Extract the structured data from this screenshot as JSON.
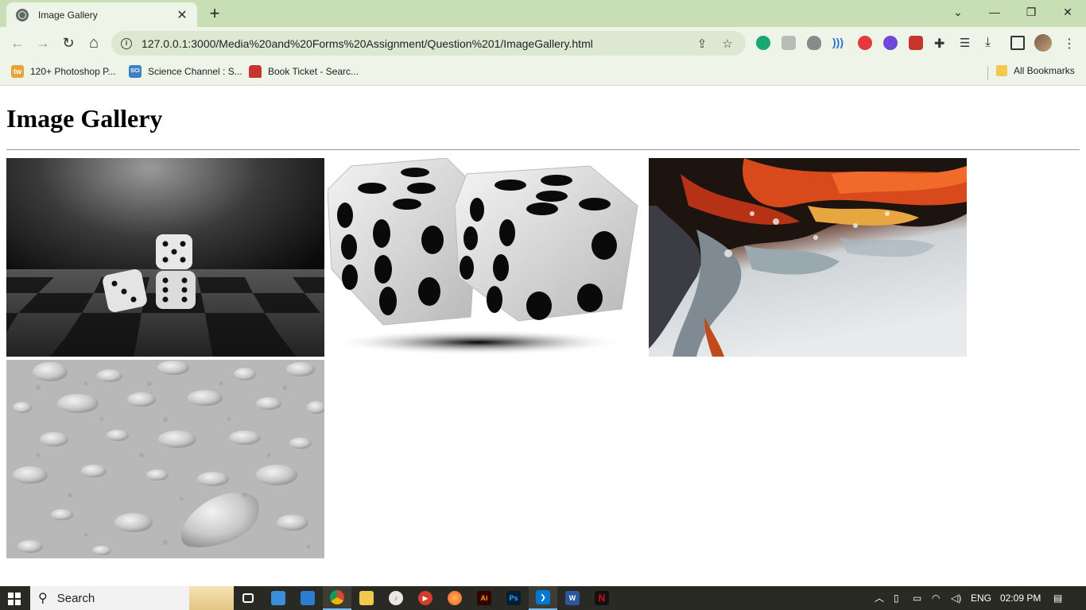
{
  "browser": {
    "tab_title": "Image Gallery",
    "tab_close": "✕",
    "new_tab": "+",
    "url": "127.0.0.1:3000/Media%20and%20Forms%20Assignment/Question%201/ImageGallery.html",
    "window_controls": {
      "dropdown": "⌄",
      "minimize": "—",
      "restore": "❐",
      "close": "✕"
    },
    "nav": {
      "back": "←",
      "forward": "→",
      "reload": "↻",
      "home": "⌂"
    }
  },
  "bookmarks": {
    "items": [
      {
        "label": "120+ Photoshop P...",
        "icon": "tw",
        "color": "#e8a23a"
      },
      {
        "label": "Science Channel : S...",
        "icon": "SCI",
        "color": "#3d7fc4"
      },
      {
        "label": "Book Ticket - Searc...",
        "icon": "bus-icon",
        "color": "#c8352c"
      }
    ],
    "all_bookmarks": "All Bookmarks"
  },
  "page": {
    "heading": "Image Gallery",
    "images": [
      {
        "name": "dice-on-chessboard"
      },
      {
        "name": "two-white-dice"
      },
      {
        "name": "abstract-fluid-art"
      },
      {
        "name": "water-droplets"
      }
    ]
  },
  "taskbar": {
    "search_label": "Search",
    "language": "ENG",
    "time": "02:09 PM"
  },
  "colors": {
    "tabbar": "#c8dfb5",
    "toolbar": "#eef5e8",
    "omnibox": "#dde8d2",
    "taskbar": "#2a2a24"
  }
}
